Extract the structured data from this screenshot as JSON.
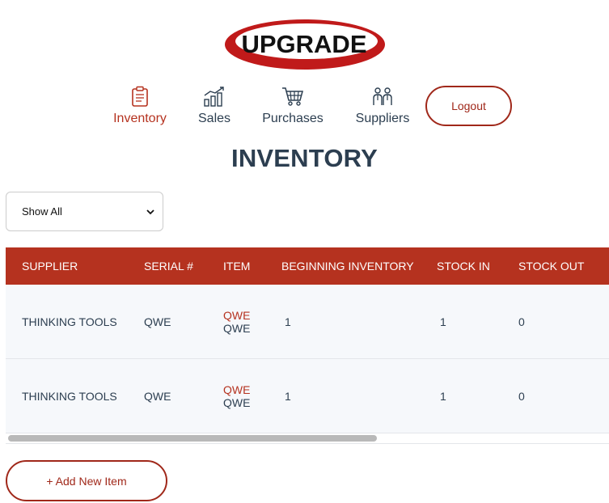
{
  "brand": {
    "logo_text": "UPGRADE",
    "accent": "#b5321f",
    "logo_red": "#c01a1a"
  },
  "nav": {
    "items": [
      {
        "label": "Inventory",
        "icon": "clipboard-icon",
        "active": true
      },
      {
        "label": "Sales",
        "icon": "bar-chart-icon",
        "active": false
      },
      {
        "label": "Purchases",
        "icon": "shopping-cart-icon",
        "active": false
      },
      {
        "label": "Suppliers",
        "icon": "people-icon",
        "active": false
      }
    ],
    "logout_label": "Logout"
  },
  "page": {
    "title": "INVENTORY"
  },
  "filter": {
    "selected": "Show All"
  },
  "table": {
    "columns": [
      "SUPPLIER",
      "SERIAL #",
      "ITEM",
      "BEGINNING INVENTORY",
      "STOCK IN",
      "STOCK OUT"
    ],
    "rows": [
      {
        "supplier": "THINKING TOOLS",
        "serial": "QWE",
        "item_name": "QWE",
        "item_desc": "QWE",
        "beginning": "1",
        "stock_in": "1",
        "stock_out": "0"
      },
      {
        "supplier": "THINKING TOOLS",
        "serial": "QWE",
        "item_name": "QWE",
        "item_desc": "QWE",
        "beginning": "1",
        "stock_in": "1",
        "stock_out": "0"
      }
    ]
  },
  "actions": {
    "add_label": "+ Add New Item"
  }
}
